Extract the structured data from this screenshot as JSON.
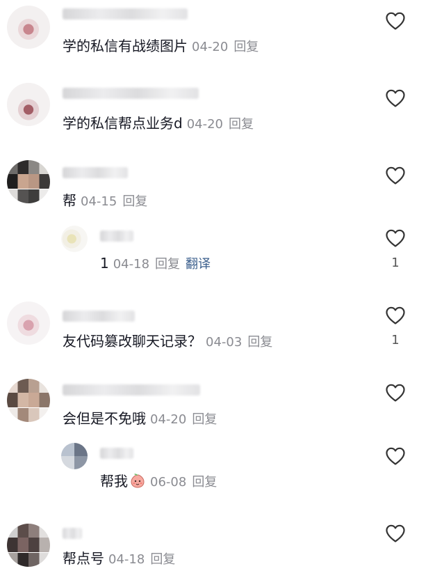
{
  "comments": [
    {
      "text": "学的私信有战绩图片",
      "date": "04-20",
      "reply": "回复"
    },
    {
      "text": "学的私信帮点业务d",
      "date": "04-20",
      "reply": "回复"
    },
    {
      "text": "帮",
      "date": "04-15",
      "reply": "回复"
    },
    {
      "text": "1",
      "date": "04-18",
      "reply": "回复",
      "translate": "翻译",
      "likes": "1"
    },
    {
      "text": "友代码篡改聊天记录？",
      "date": "04-03",
      "reply": "回复",
      "likes": "1"
    },
    {
      "text": "会但是不免哦",
      "date": "04-20",
      "reply": "回复"
    },
    {
      "text": "帮我",
      "date": "06-08",
      "reply": "回复"
    },
    {
      "text": "帮点号",
      "date": "04-18",
      "reply": "回复"
    }
  ],
  "icons": {
    "like": "heart-outline-icon",
    "emoji": "peach-face-emoji-icon"
  },
  "colors": {
    "text": "#161823",
    "meta": "#8a8b91",
    "link": "#3a5e8c",
    "icon": "#333333"
  }
}
